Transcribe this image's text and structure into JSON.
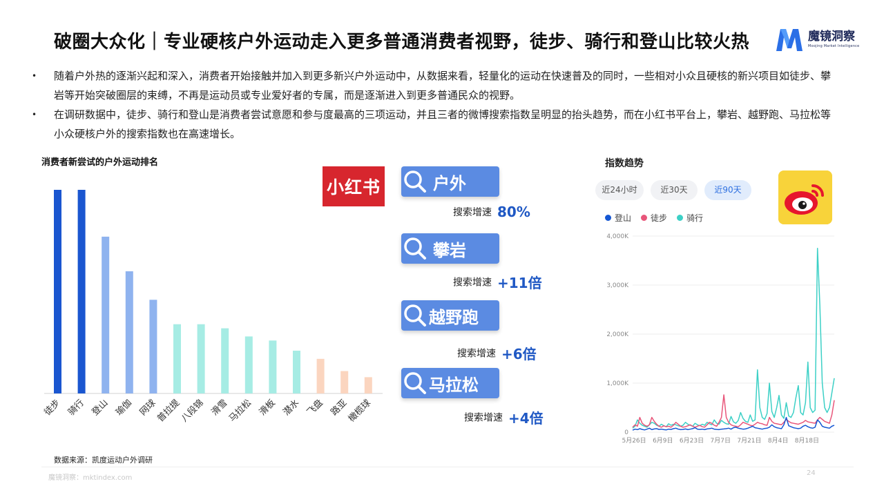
{
  "title": "破圈大众化｜专业硬核户外运动走入更多普通消费者视野，徒步、骑行和登山比较火热",
  "brand": {
    "name_cn": "魔镜洞察",
    "name_en": "Moojing Market Intelligence"
  },
  "bullets": [
    {
      "marker": "•",
      "text": "随着户外热的逐渐兴起和深入，消费者开始接触并加入到更多新兴户外运动中，从数据来看，轻量化的运动在快速普及的同时，一些相对小众且硬核的新兴项目如徒步、攀岩等开始突破圈层的束缚，不再是运动员或专业爱好者的专属，而是逐渐进入到更多普通民众的视野。"
    },
    {
      "marker": "•",
      "text": "在调研数据中，徒步、骑行和登山是消费者尝试意愿和参与度最高的三项运动，并且三者的微博搜索指数呈明显的抬头趋势，而在小红书平台上，攀岩、越野跑、马拉松等小众硬核户外的搜索指数也在高速增长。"
    }
  ],
  "left_chart_title": "消费者新尝试的户外运动排名",
  "chart_data": [
    {
      "type": "bar",
      "title": "消费者新尝试的户外运动排名",
      "categories": [
        "徒步",
        "骑行",
        "登山",
        "瑜伽",
        "网球",
        "普拉提",
        "八段锦",
        "滑雪",
        "马拉松",
        "滑板",
        "潜水",
        "飞盘",
        "路亚",
        "橄榄球"
      ],
      "values": [
        100,
        100,
        77,
        60,
        46,
        34,
        34,
        32,
        28,
        26,
        21,
        17,
        11,
        8
      ],
      "colors": [
        "#1a56d0",
        "#1a56d0",
        "#8fb3ef",
        "#8fb3ef",
        "#8fb3ef",
        "#a6ece4",
        "#a6ece4",
        "#a6ece4",
        "#a6ece4",
        "#a6ece4",
        "#a6ece4",
        "#fbd5bf",
        "#fbd5bf",
        "#fbd5bf"
      ],
      "ylim": [
        0,
        100
      ],
      "grid": false
    },
    {
      "type": "line",
      "title": "指数趋势",
      "x_ticks": [
        "5月26日",
        "6月9日",
        "6月23日",
        "7月7日",
        "7月21日",
        "8月4日",
        "8月18日"
      ],
      "y_ticks": [
        "0",
        "1,000K",
        "2,000K",
        "3,000K",
        "4,000K"
      ],
      "ylim": [
        0,
        4000
      ],
      "grid": true,
      "legend_position": "top-left",
      "series": [
        {
          "name": "登山",
          "color": "#1557d3",
          "values": [
            40,
            60,
            50,
            70,
            55,
            45,
            60,
            80,
            50,
            65,
            70,
            55,
            60,
            50,
            45,
            60,
            55,
            70,
            80,
            60,
            50,
            55,
            65,
            50,
            60,
            70,
            90,
            60,
            55,
            60,
            50,
            65,
            70,
            80,
            60,
            55,
            50,
            60,
            65,
            70,
            80,
            60,
            90,
            100,
            80,
            70,
            60,
            65,
            80,
            100,
            120,
            90,
            80,
            70,
            60,
            75,
            80,
            100,
            150,
            110,
            90,
            80,
            70,
            150,
            300,
            130,
            110,
            90,
            80,
            70,
            80,
            120,
            140,
            110,
            90,
            80,
            100,
            250,
            200,
            120,
            100,
            90,
            80,
            120,
            140
          ]
        },
        {
          "name": "徒步",
          "color": "#e8567a",
          "values": [
            100,
            150,
            120,
            300,
            180,
            140,
            120,
            150,
            300,
            220,
            160,
            120,
            100,
            130,
            110,
            120,
            100,
            140,
            200,
            160,
            120,
            100,
            110,
            130,
            150,
            120,
            100,
            120,
            140,
            110,
            100,
            150,
            200,
            180,
            140,
            120,
            200,
            300,
            760,
            300,
            200,
            150,
            130,
            120,
            110,
            150,
            200,
            180,
            160,
            140,
            130,
            160,
            200,
            180,
            170,
            150,
            140,
            300,
            220,
            180,
            170,
            160,
            150,
            200,
            260,
            220,
            190,
            180,
            170,
            160,
            180,
            200,
            240,
            210,
            200,
            190,
            180,
            250,
            300,
            260,
            220,
            200,
            180,
            350,
            650
          ]
        },
        {
          "name": "骑行",
          "color": "#3cd0c6",
          "values": [
            80,
            120,
            250,
            180,
            140,
            120,
            100,
            150,
            200,
            180,
            140,
            120,
            160,
            130,
            110,
            170,
            140,
            160,
            150,
            130,
            120,
            140,
            200,
            160,
            140,
            120,
            180,
            150,
            130,
            160,
            140,
            200,
            170,
            150,
            250,
            180,
            160,
            240,
            200,
            170,
            160,
            320,
            210,
            180,
            240,
            400,
            280,
            220,
            200,
            350,
            220,
            250,
            1270,
            500,
            300,
            260,
            380,
            1000,
            420,
            300,
            500,
            750,
            350,
            280,
            600,
            330,
            300,
            400,
            700,
            950,
            400,
            350,
            600,
            1430,
            500,
            400,
            450,
            3750,
            2600,
            1000,
            500,
            400,
            500,
            800,
            1100
          ]
        }
      ]
    }
  ],
  "xiaohongshu": {
    "logo_text": "小红书",
    "items": [
      {
        "label": "户外",
        "stat_label": "搜索增速",
        "stat_value": "80%"
      },
      {
        "label": "攀岩",
        "stat_label": "搜索增速",
        "stat_value": "+11倍"
      },
      {
        "label": "越野跑",
        "stat_label": "搜索增速",
        "stat_value": "+6倍"
      },
      {
        "label": "马拉松",
        "stat_label": "搜索增速",
        "stat_value": "+4倍"
      }
    ]
  },
  "trend": {
    "title": "指数趋势",
    "tabs": [
      {
        "label": "近24小时",
        "active": false
      },
      {
        "label": "近30天",
        "active": false
      },
      {
        "label": "近90天",
        "active": true
      }
    ],
    "legend": [
      {
        "label": "登山",
        "color": "#1557d3"
      },
      {
        "label": "徒步",
        "color": "#e8567a"
      },
      {
        "label": "骑行",
        "color": "#3cd0c6"
      }
    ]
  },
  "source": "数据来源：凯度运动户外调研",
  "footer": {
    "site": "魔镜洞察：mktindex.com",
    "page": "24"
  },
  "icons": {
    "search": "search-icon",
    "weibo": "weibo-logo",
    "brand": "moojing-logo-icon"
  }
}
